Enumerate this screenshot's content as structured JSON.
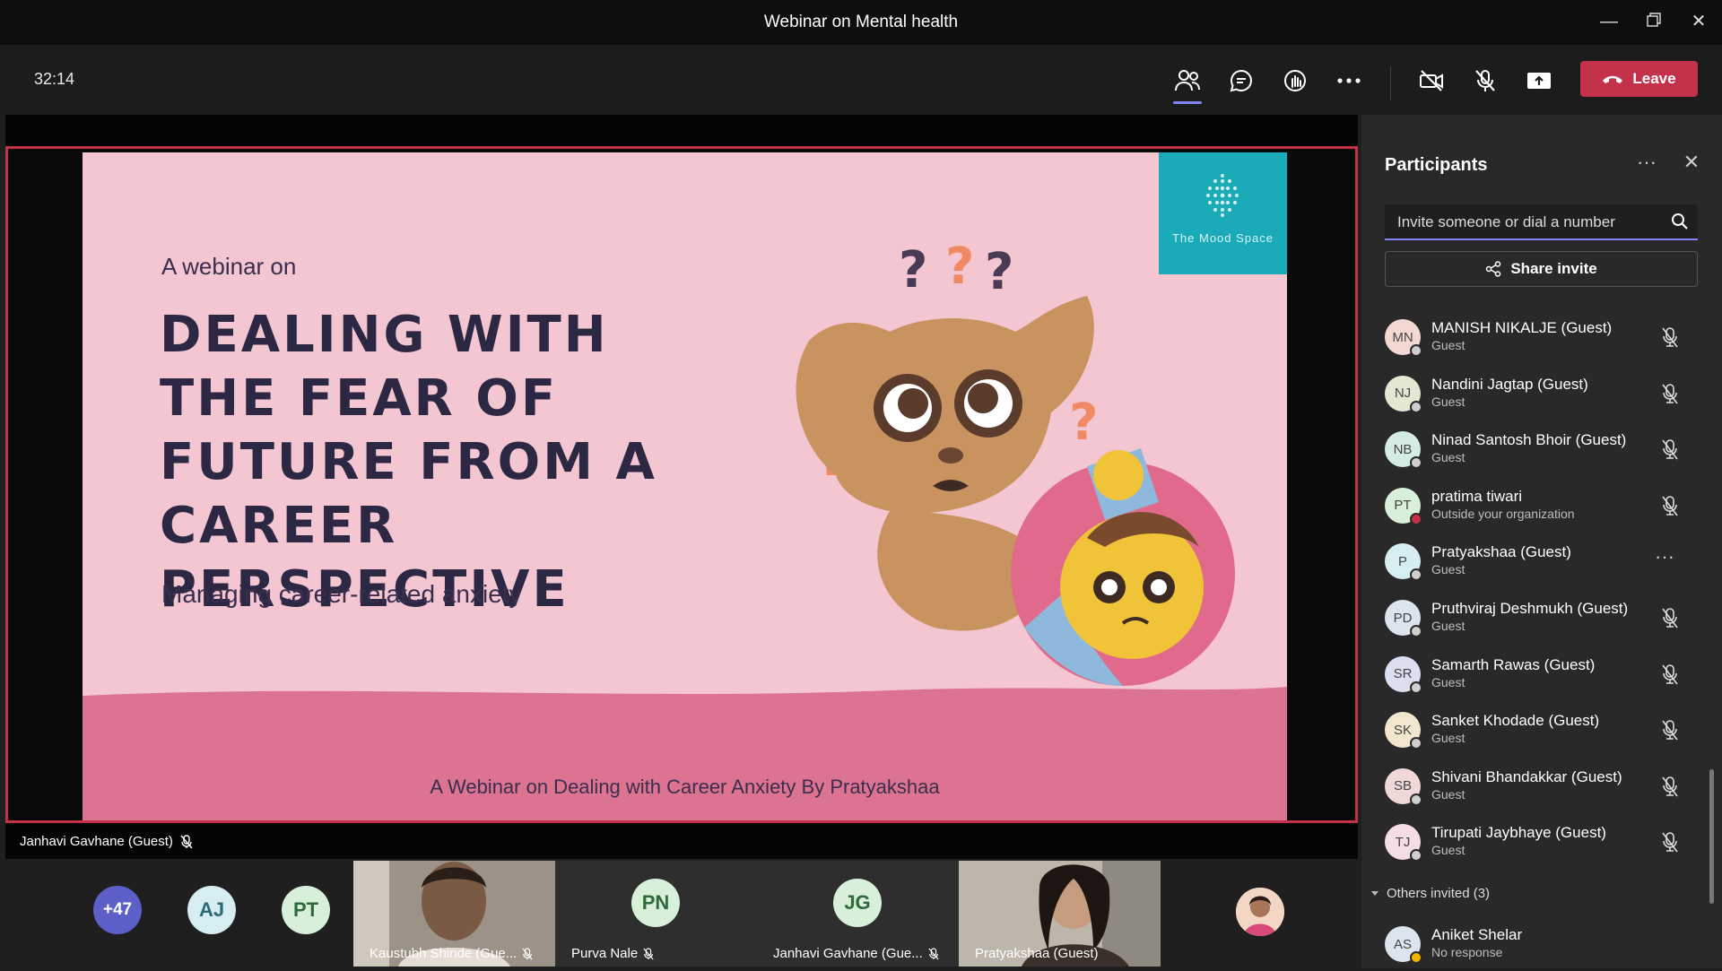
{
  "window": {
    "title": "Webinar on Mental health"
  },
  "toolbar": {
    "timer": "32:14",
    "leave_label": "Leave"
  },
  "slide": {
    "intro": "A webinar on",
    "headline": "DEALING WITH THE FEAR OF FUTURE FROM A CAREER PERSPECTIVE",
    "subtitle": "Managing career-related anxiety",
    "logo_text": "The Mood Space",
    "footer": "A Webinar on Dealing with Career Anxiety  By Pratyakshaa",
    "colors": {
      "background": "#f3c6d1",
      "bottom_band": "#dc7390",
      "logo_box": "#1aaab8",
      "text": "#2c2843"
    }
  },
  "presenter": {
    "name": "Janhavi Gavhane (Guest)"
  },
  "gallery": {
    "overflow_count": "+47",
    "tiles": [
      {
        "initials": "AJ"
      },
      {
        "initials": "PT"
      },
      {
        "name": "Kaustubh Shinde (Gue..."
      },
      {
        "initials": "PN",
        "name": "Purva Nale"
      },
      {
        "initials": "JG",
        "name": "Janhavi Gavhane (Gue..."
      },
      {
        "name": "Pratyakshaa (Guest)"
      }
    ]
  },
  "panel": {
    "title": "Participants",
    "invite_placeholder": "Invite someone or dial a number",
    "share_invite_label": "Share invite",
    "participants": [
      {
        "initials": "MN",
        "name": "MANISH NIKALJE (Guest)",
        "role": "Guest",
        "avatar_color": "#f4d9d2"
      },
      {
        "initials": "NJ",
        "name": "Nandini Jagtap (Guest)",
        "role": "Guest",
        "avatar_color": "#e3e8d2"
      },
      {
        "initials": "NB",
        "name": "Ninad Santosh Bhoir (Guest)",
        "role": "Guest",
        "avatar_color": "#d4ebe6"
      },
      {
        "initials": "PT",
        "name": "pratima tiwari",
        "role": "Outside your organization",
        "avatar_color": "#d8efd9"
      },
      {
        "initials": "P",
        "name": "Pratyakshaa (Guest)",
        "role": "Guest",
        "avatar_color": "#d6eef2"
      },
      {
        "initials": "PD",
        "name": "Pruthviraj Deshmukh (Guest)",
        "role": "Guest",
        "avatar_color": "#dce4f0"
      },
      {
        "initials": "SR",
        "name": "Samarth Rawas (Guest)",
        "role": "Guest",
        "avatar_color": "#dcdff0"
      },
      {
        "initials": "SK",
        "name": "Sanket Khodade (Guest)",
        "role": "Guest",
        "avatar_color": "#f3e6cf"
      },
      {
        "initials": "SB",
        "name": "Shivani Bhandakkar (Guest)",
        "role": "Guest",
        "avatar_color": "#f0d8d8"
      },
      {
        "initials": "TJ",
        "name": "Tirupati Jaybhaye (Guest)",
        "role": "Guest",
        "avatar_color": "#f4dde6"
      }
    ],
    "others_label": "Others invited (3)",
    "others": [
      {
        "initials": "AS",
        "name": "Aniket Shelar",
        "role": "No response",
        "avatar_color": "#dce4f0"
      }
    ]
  }
}
